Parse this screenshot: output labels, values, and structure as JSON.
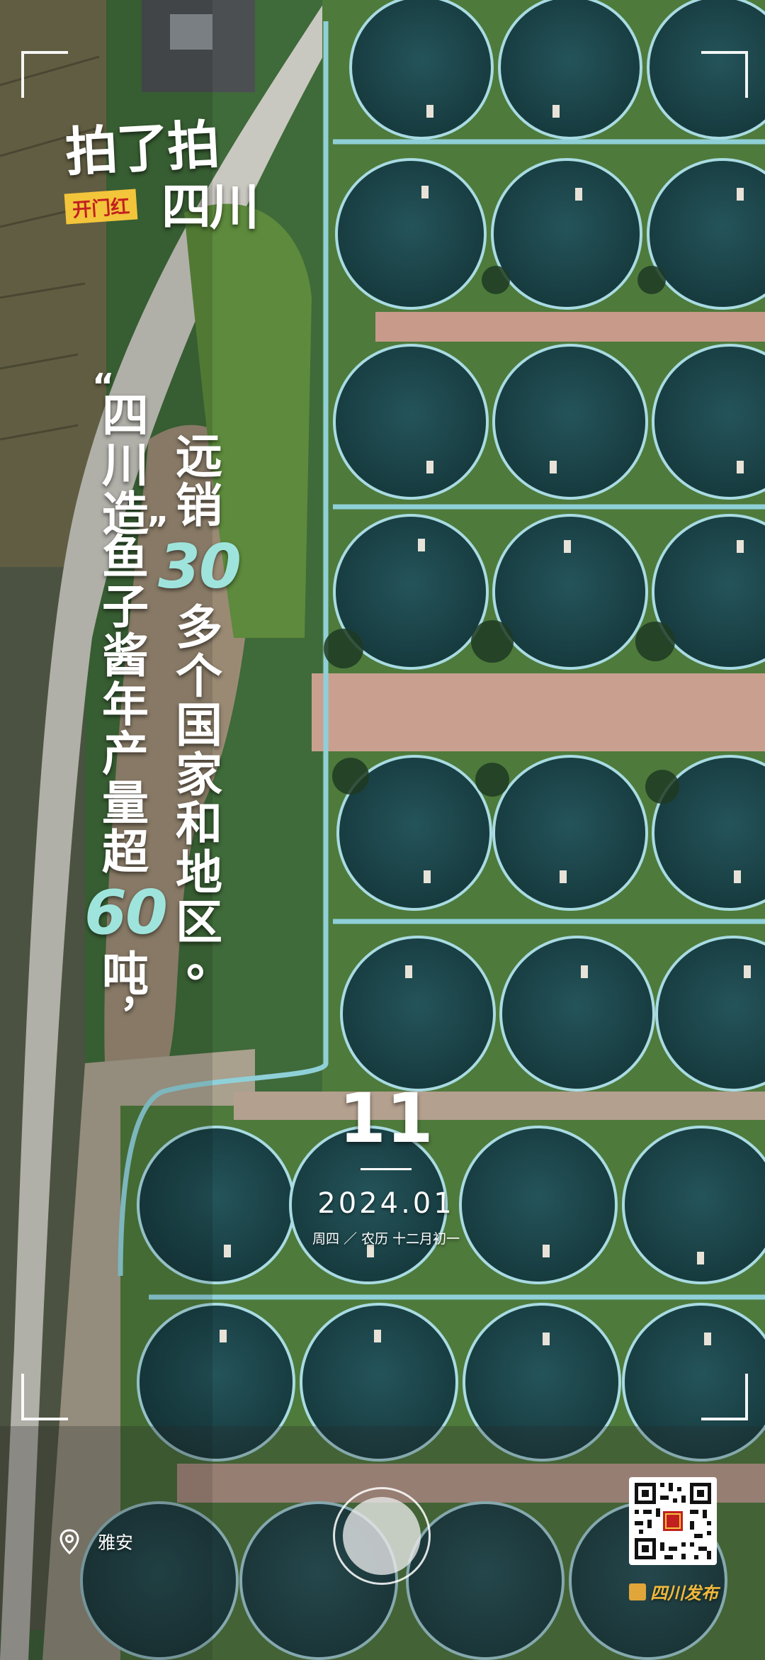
{
  "logo": {
    "line1": "拍了拍",
    "line2": "四川",
    "badge": "开门红"
  },
  "headline_left": {
    "open_quote": "“",
    "part1": [
      "四",
      "川",
      "造"
    ],
    "close_quote": "”",
    "part2": [
      "鱼",
      "子",
      "酱",
      "年",
      "产",
      "量",
      "超"
    ],
    "number": "60",
    "part3": [
      "吨",
      "，"
    ]
  },
  "headline_right": {
    "part1": [
      "远",
      "销"
    ],
    "number": "30",
    "part2": [
      "多",
      "个",
      "国",
      "家",
      "和",
      "地",
      "区",
      "。"
    ]
  },
  "date": {
    "day": "11",
    "year_month": "2024.01",
    "weekday_lunar": "周四 ／ 农历 十二月初一"
  },
  "location": {
    "icon": "location-pin-icon",
    "name": "雅安"
  },
  "publisher": {
    "name": "四川发布",
    "qr_label": "QR code"
  },
  "colors": {
    "accent_teal": "#9fe4dc",
    "badge_red": "#c22020",
    "pond": "#1c4548",
    "pond_rim": "#9ed4dc"
  }
}
